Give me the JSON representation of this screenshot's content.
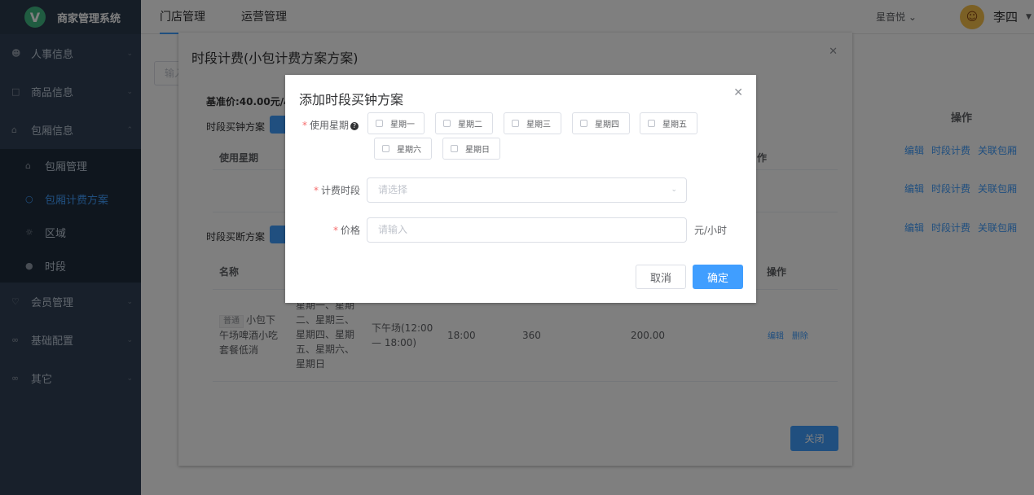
{
  "app": {
    "logo_letter": "V",
    "title": "商家管理系统"
  },
  "header": {
    "tabs": [
      {
        "label": "门店管理"
      },
      {
        "label": "运营管理"
      }
    ],
    "store": "星音悦",
    "user": "李四"
  },
  "sidebar": {
    "items": [
      {
        "label": "人事信息"
      },
      {
        "label": "商品信息"
      },
      {
        "label": "包厢信息"
      }
    ],
    "sub_items": [
      {
        "label": "包厢管理"
      },
      {
        "label": "包厢计费方案"
      },
      {
        "label": "区域"
      },
      {
        "label": "时段"
      }
    ],
    "items_after": [
      {
        "label": "会员管理"
      },
      {
        "label": "基础配置"
      },
      {
        "label": "其它"
      }
    ]
  },
  "background": {
    "search_placeholder": "输入",
    "op_header": "操作",
    "row_actions": [
      "编辑",
      "时段计费",
      "关联包厢"
    ]
  },
  "dialog1": {
    "title": "时段计费(小包计费方案方案)",
    "base_price": "基准价:40.00元/小",
    "section1_label": "时段买钟方案",
    "col_week": "使用星期",
    "col_op_partial": "作",
    "section2_label": "时段买断方案",
    "col_name": "名称",
    "col_op": "操作",
    "row": {
      "tag": "普通",
      "name": "小包下午场啤酒小吃套餐低消",
      "weekdays": "星期一、星期二、星期三、星期四、星期五、星期六、星期日",
      "period": "下午场(12:00 — 18:00)",
      "time": "18:00",
      "minutes": "360",
      "price": "200.00",
      "edit": "编辑",
      "delete": "删除"
    },
    "close_button": "关闭"
  },
  "dialog2": {
    "title": "添加时段买钟方案",
    "weekday_label": "使用星期",
    "weekdays": [
      "星期一",
      "星期二",
      "星期三",
      "星期四",
      "星期五",
      "星期六",
      "星期日"
    ],
    "period_label": "计费时段",
    "period_placeholder": "请选择",
    "price_label": "价格",
    "price_placeholder": "请输入",
    "price_unit": "元/小时",
    "cancel": "取消",
    "confirm": "确定"
  }
}
